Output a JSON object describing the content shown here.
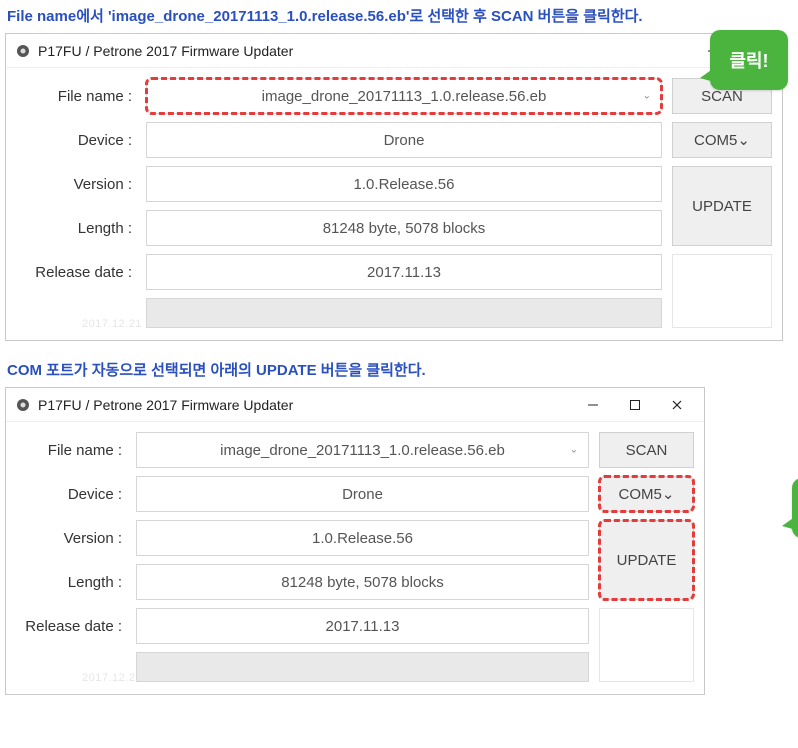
{
  "instruction1": "File name에서 'image_drone_20171113_1.0.release.56.eb'로  선택한 후 SCAN 버튼을 클릭한다.",
  "instruction2": "COM 포트가 자동으로 선택되면 아래의 UPDATE 버튼을 클릭한다.",
  "window_title": "P17FU / Petrone 2017 Firmware Updater",
  "labels": {
    "file_name": "File name :",
    "device": "Device :",
    "version": "Version :",
    "length": "Length :",
    "release_date": "Release date :"
  },
  "fields": {
    "file_name": "image_drone_20171113_1.0.release.56.eb",
    "device": "Drone",
    "version": "1.0.Release.56",
    "length": "81248 byte, 5078 blocks",
    "release_date": "2017.11.13"
  },
  "buttons": {
    "scan": "SCAN",
    "com": "COM5",
    "update": "UPDATE"
  },
  "callout": "클릭!",
  "watermark": "2017.12.21"
}
